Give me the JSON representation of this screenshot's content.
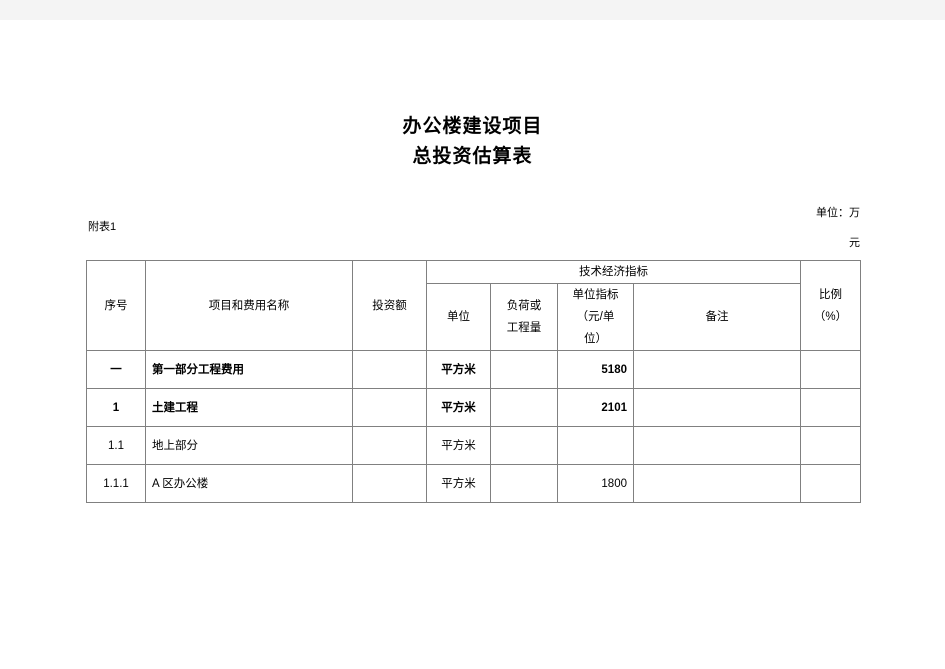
{
  "document": {
    "title_line1": "办公楼建设项目",
    "title_line2": "总投资估算表",
    "unit_note_line1": "单位：万",
    "unit_note_line2": "元",
    "attachment_label": "附表1"
  },
  "table": {
    "headers": {
      "seq": "序号",
      "item_name": "项目和费用名称",
      "investment": "投资额",
      "tech_economic_index": "技术经济指标",
      "unit": "单位",
      "load_or_quantity": "负荷或\n工程量",
      "unit_index": "单位指标\n（元/单\n位）",
      "remark": "备注",
      "ratio": "比例\n（%）"
    },
    "rows": [
      {
        "seq": "一",
        "name": "第一部分工程费用",
        "investment": "",
        "unit": "平方米",
        "load": "",
        "unit_index": "5180",
        "remark": "",
        "ratio": "",
        "bold": true
      },
      {
        "seq": "1",
        "name": "土建工程",
        "investment": "",
        "unit": "平方米",
        "load": "",
        "unit_index": "2101",
        "remark": "",
        "ratio": "",
        "bold": true
      },
      {
        "seq": "1.1",
        "name": "地上部分",
        "investment": "",
        "unit": "平方米",
        "load": "",
        "unit_index": "",
        "remark": "",
        "ratio": "",
        "bold": false
      },
      {
        "seq": "1.1.1",
        "name": "A 区办公楼",
        "investment": "",
        "unit": "平方米",
        "load": "",
        "unit_index": "1800",
        "remark": "",
        "ratio": "",
        "bold": false
      }
    ]
  }
}
